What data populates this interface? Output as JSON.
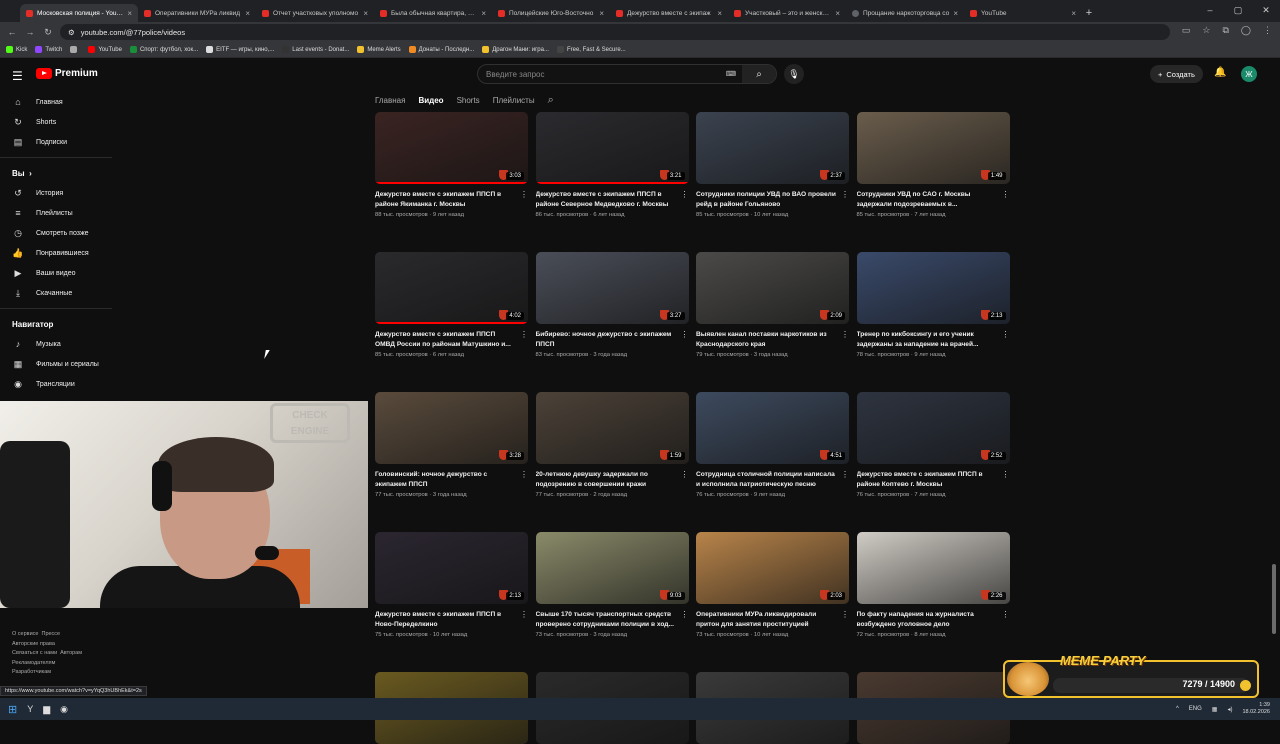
{
  "browser": {
    "tabs": [
      {
        "title": "Московская полиция - YouTube",
        "active": true
      },
      {
        "title": "Оперативники МУРа ликвид",
        "active": false
      },
      {
        "title": "Отчет участковых уполномо",
        "active": false
      },
      {
        "title": "Была обычная квартира, а ст",
        "active": false
      },
      {
        "title": "Полицейские Юго-Восточно",
        "active": false
      },
      {
        "title": "Дежурство вместе с экипаж",
        "active": false
      },
      {
        "title": "Участковый – это и женская п",
        "active": false
      },
      {
        "title": "Прощание наркоторговца со",
        "active": false
      },
      {
        "title": "YouTube",
        "active": false
      }
    ],
    "url": "youtube.com/@77police/videos",
    "bookmarks": [
      {
        "label": "Kick",
        "color": "#53fc18"
      },
      {
        "label": "Twitch",
        "color": "#9146ff"
      },
      {
        "label": "",
        "color": "#aaaaaa"
      },
      {
        "label": "YouTube",
        "color": "#ff0000"
      },
      {
        "label": "Спорт: футбол, хок...",
        "color": "#1a8f3a"
      },
      {
        "label": "EITF — игры, кино,...",
        "color": "#dddddd"
      },
      {
        "label": "Last events - Donat...",
        "color": "#333333"
      },
      {
        "label": "Meme Alerts",
        "color": "#f1c22e"
      },
      {
        "label": "Донаты - Последн...",
        "color": "#f08a24"
      },
      {
        "label": "Драгон Мани: игра...",
        "color": "#f1c22e"
      },
      {
        "label": "Free, Fast & Secure...",
        "color": "#444444"
      }
    ],
    "status_url": "https://www.youtube.com/watch?v=yYqQ3hUBhEk&t=2s"
  },
  "youtube": {
    "logo": "Premium",
    "search_placeholder": "Введите запрос",
    "create_label": "Создать",
    "avatar_letter": "Ж",
    "sidebar_main": [
      {
        "icon": "home-icon",
        "glyph": "⌂",
        "label": "Главная"
      },
      {
        "icon": "shorts-icon",
        "glyph": "↻",
        "label": "Shorts"
      },
      {
        "icon": "subscriptions-icon",
        "glyph": "▤",
        "label": "Подписки"
      }
    ],
    "you_heading": "Вы",
    "sidebar_you": [
      {
        "icon": "history-icon",
        "glyph": "↺",
        "label": "История"
      },
      {
        "icon": "playlists-icon",
        "glyph": "≡",
        "label": "Плейлисты"
      },
      {
        "icon": "watch-later-icon",
        "glyph": "◷",
        "label": "Смотреть позже"
      },
      {
        "icon": "liked-icon",
        "glyph": "👍",
        "label": "Понравившиеся"
      },
      {
        "icon": "your-videos-icon",
        "glyph": "▶",
        "label": "Ваши видео"
      },
      {
        "icon": "downloads-icon",
        "glyph": "⤓",
        "label": "Скачанные"
      }
    ],
    "nav_heading": "Навигатор",
    "sidebar_nav": [
      {
        "icon": "music-icon",
        "glyph": "♪",
        "label": "Музыка"
      },
      {
        "icon": "movies-icon",
        "glyph": "▦",
        "label": "Фильмы и сериалы"
      },
      {
        "icon": "live-icon",
        "glyph": "◉",
        "label": "Трансляции"
      }
    ],
    "footer_links": [
      "О сервисе",
      "Прессе",
      "Авторские права",
      "Связаться с нами",
      "Авторам",
      "Рекламодателям",
      "Разработчикам"
    ],
    "channel_tabs": [
      {
        "label": "Главная",
        "active": false
      },
      {
        "label": "Видео",
        "active": true
      },
      {
        "label": "Shorts",
        "active": false
      },
      {
        "label": "Плейлисты",
        "active": false
      }
    ],
    "videos": [
      {
        "title": "Дежурство вместе с экипажем ППСП в районе Якиманка г. Москвы",
        "meta": "88 тыс. просмотров · 9 лет назад",
        "duration": "3:03",
        "bg": "#3a2422",
        "progress": 1.0
      },
      {
        "title": "Дежурство вместе с экипажем ППСП в районе Северное Медведково г. Москвы",
        "meta": "86 тыс. просмотров · 6 лет назад",
        "duration": "3:21",
        "bg": "#2b2a2e",
        "progress": 1.0
      },
      {
        "title": "Сотрудники полиции УВД по ВАО провели рейд в районе Гольяново",
        "meta": "85 тыс. просмотров · 10 лет назад",
        "duration": "2:37",
        "bg": "#3b4350",
        "progress": 0
      },
      {
        "title": "Сотрудники УВД по САО г. Москвы задержали подозреваемых в...",
        "meta": "85 тыс. просмотров · 7 лет назад",
        "duration": "1:49",
        "bg": "#6a5d4c",
        "progress": 0
      },
      {
        "title": "Дежурство вместе с экипажем ППСП ОМВД России по районам Матушкино и...",
        "meta": "85 тыс. просмотров · 6 лет назад",
        "duration": "4:02",
        "bg": "#2a2a2d",
        "progress": 1.0
      },
      {
        "title": "Бибирево: ночное дежурство с экипажем ППСП",
        "meta": "83 тыс. просмотров · 3 года назад",
        "duration": "3:27",
        "bg": "#4a4e58",
        "progress": 0
      },
      {
        "title": "Выявлен канал поставки наркотиков из Краснодарского края",
        "meta": "79 тыс. просмотров · 3 года назад",
        "duration": "2:09",
        "bg": "#4b4a48",
        "progress": 0
      },
      {
        "title": "Тренер по кикбоксингу и его ученик задержаны за нападение на врачей...",
        "meta": "78 тыс. просмотров · 9 лет назад",
        "duration": "2:13",
        "bg": "#3a4a6a",
        "progress": 0
      },
      {
        "title": "Головинский: ночное дежурство с экипажем ППСП",
        "meta": "77 тыс. просмотров · 3 года назад",
        "duration": "3:28",
        "bg": "#5a4b3c",
        "progress": 0
      },
      {
        "title": "20-летнюю девушку задержали по подозрению в совершении кражи",
        "meta": "77 тыс. просмотров · 2 года назад",
        "duration": "1:59",
        "bg": "#4c4238",
        "progress": 0
      },
      {
        "title": "Сотрудница столичной полиции написала и исполнила патриотическую песню",
        "meta": "76 тыс. просмотров · 9 лет назад",
        "duration": "4:51",
        "bg": "#3d4a5e",
        "progress": 0
      },
      {
        "title": "Дежурство вместе с экипажем ППСП в районе Коптево г. Москвы",
        "meta": "76 тыс. просмотров · 7 лет назад",
        "duration": "2:52",
        "bg": "#2e3440",
        "progress": 0
      },
      {
        "title": "Дежурство вместе с экипажем ППСП в Ново-Переделкино",
        "meta": "75 тыс. просмотров · 10 лет назад",
        "duration": "2:13",
        "bg": "#2b2630",
        "progress": 0
      },
      {
        "title": "Свыше 170 тысяч транспортных средств проверено сотрудниками полиции в ход...",
        "meta": "73 тыс. просмотров · 3 года назад",
        "duration": "9:03",
        "bg": "#8a8a6a",
        "progress": 0
      },
      {
        "title": "Оперативники МУРа ликвидировали притон для занятия проституцией",
        "meta": "73 тыс. просмотров · 10 лет назад",
        "duration": "2:03",
        "bg": "#b8844a",
        "progress": 0
      },
      {
        "title": "По факту нападения на журналиста возбуждено уголовное дело",
        "meta": "72 тыс. просмотров · 8 лет назад",
        "duration": "2:26",
        "bg": "#d0ccc5",
        "progress": 0
      },
      {
        "title": "",
        "meta": "",
        "duration": "",
        "bg": "#6a5a20",
        "progress": 0
      },
      {
        "title": "",
        "meta": "",
        "duration": "",
        "bg": "#2a2a2a",
        "progress": 0
      },
      {
        "title": "",
        "meta": "",
        "duration": "",
        "bg": "#3a3a3a",
        "progress": 0
      },
      {
        "title": "",
        "meta": "",
        "duration": "",
        "bg": "#4a3a30",
        "progress": 0
      }
    ]
  },
  "overlay": {
    "webcam_sign": "CHECK ENGINE",
    "meme_title": "MEME PARTY",
    "meme_count": "7279 / 14900"
  },
  "taskbar": {
    "lang": "ENG",
    "time": "1:39",
    "date": "18.02.2026"
  }
}
